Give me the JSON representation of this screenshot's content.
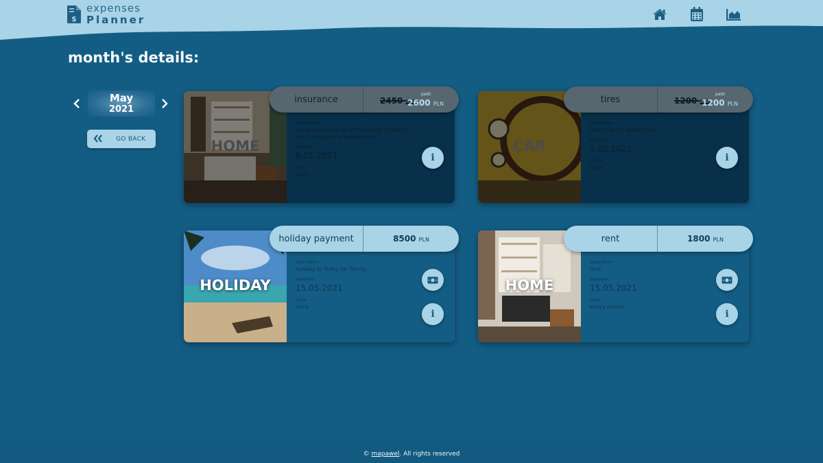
{
  "logo": {
    "line1": "expenses",
    "line2": "Planner",
    "icon": "invoice-dollar-icon"
  },
  "nav": {
    "icons": [
      "home-icon",
      "calendar-icon",
      "chart-icon"
    ]
  },
  "page_title": "month's details:",
  "month_picker": {
    "month": "May",
    "year": "2021",
    "prev_icon": "chevron-left-icon",
    "next_icon": "chevron-right-icon"
  },
  "go_back": {
    "label": "GO BACK",
    "icon": "double-chevron-left-icon"
  },
  "cards": [
    {
      "category": "HOME",
      "name": "insurance",
      "amount": "2450",
      "paid_label": "paid:",
      "paid_amount": "2600",
      "currency": "PLN",
      "status": "paid",
      "description_label": "description:",
      "description": "home insuracne in XY company (I think I must change the agreement)",
      "deadline_label": "deadline:",
      "deadline": "8.05.2021",
      "cycle_label": "cycle:",
      "cycle": "once"
    },
    {
      "category": "CAR",
      "name": "tires",
      "amount": "1200",
      "paid_label": "paid:",
      "paid_amount": "1200",
      "currency": "PLN",
      "status": "paid",
      "description_label": "description:",
      "description": "new tires for winter-time",
      "deadline_label": "deadline:",
      "deadline": "9.05.2021",
      "cycle_label": "cycle:",
      "cycle": "once"
    },
    {
      "category": "HOLIDAY",
      "name": "holiday payment",
      "amount": "8500",
      "currency": "PLN",
      "status": "unpaid",
      "description_label": "description:",
      "description": "holiday in Turky for family",
      "deadline_label": "deadline:",
      "deadline": "15.05.2021",
      "cycle_label": "cycle:",
      "cycle": "once"
    },
    {
      "category": "HOME",
      "name": "rent",
      "amount": "1800",
      "currency": "PLN",
      "status": "unpaid",
      "description_label": "description:",
      "description": "rent",
      "deadline_label": "deadline:",
      "deadline": "15.05.2021",
      "cycle_label": "cycle:",
      "cycle": "every month"
    }
  ],
  "footer": {
    "copyright": "©",
    "author": "mapawel",
    "rights": ". All rights reserved"
  },
  "colors": {
    "background": "#135d84",
    "header": "#a9d3e6",
    "pill": "#a9d3e6",
    "paid_card": "#08304a"
  }
}
